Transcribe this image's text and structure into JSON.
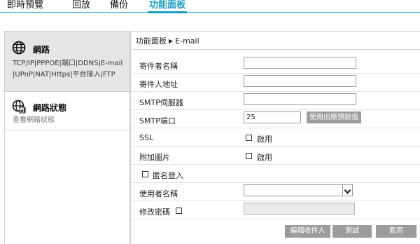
{
  "nav": {
    "tabs": [
      {
        "label": "即時預覽",
        "active": false
      },
      {
        "label": "回放",
        "active": false
      },
      {
        "label": "備份",
        "active": false
      },
      {
        "label": "功能面板",
        "active": true
      }
    ]
  },
  "sidebar": {
    "items": [
      {
        "icon": "globe-icon",
        "title": "網路",
        "sub_lines": [
          "TCP/IP|PPPOE|端口|DDNS|E-mail",
          "|UPnP|NAT|Https|平台接入|FTP"
        ]
      },
      {
        "icon": "network-status-icon",
        "title": "網路狀態",
        "sub_lines": [
          "查看網路狀態"
        ]
      }
    ]
  },
  "breadcrumb": {
    "parent": "功能面板",
    "separator": "▶",
    "current": "E-mail"
  },
  "form": {
    "sender_name": {
      "label": "寄件者名稱",
      "value": ""
    },
    "sender_address": {
      "label": "寄件人地址",
      "value": ""
    },
    "smtp_server": {
      "label": "SMTP伺服器",
      "value": ""
    },
    "smtp_port": {
      "label": "SMTP端口",
      "value": "25",
      "default_button": "使用出廠預設值"
    },
    "ssl": {
      "label": "SSL",
      "checkbox_label": "啟用",
      "checked": false
    },
    "attach_image": {
      "label": "附加圖片",
      "checkbox_label": "啟用",
      "checked": false
    },
    "anonymous_login": {
      "label": "匿名登入",
      "checked": false
    },
    "username": {
      "label": "使用者名稱",
      "value": ""
    },
    "change_password": {
      "label": "修改密碼",
      "checked": false,
      "value": ""
    }
  },
  "actions": {
    "edit_recipients": "編輯收件人",
    "test": "測試",
    "apply": "套用"
  },
  "colors": {
    "accent": "#1aa0c6",
    "button": "#9c9c9c",
    "sidebar_active": "#e6e6e6"
  }
}
